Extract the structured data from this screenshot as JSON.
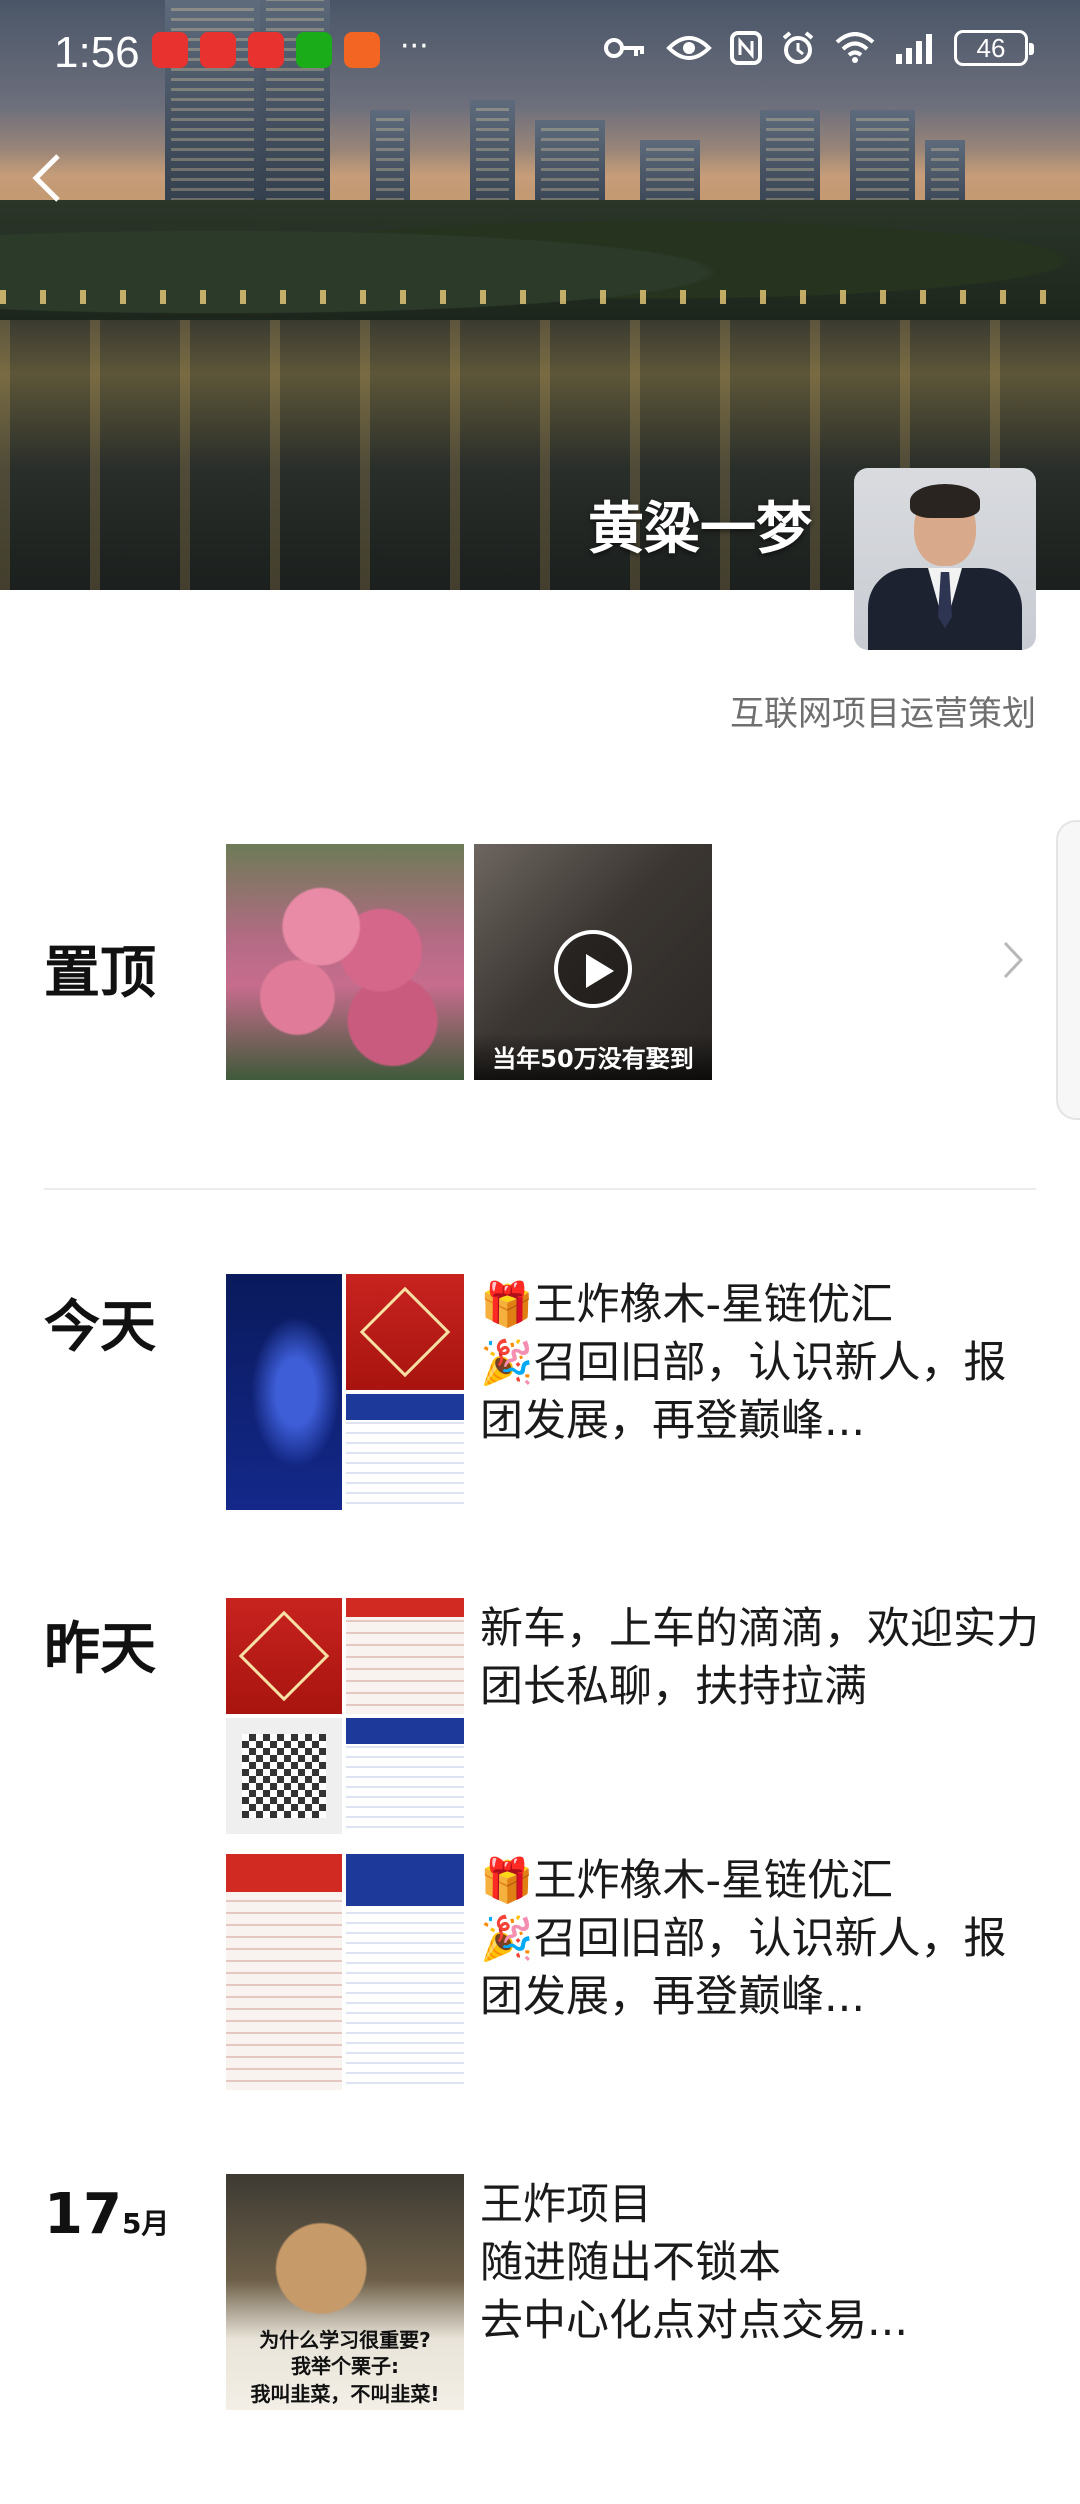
{
  "status_bar": {
    "time": "1:56",
    "battery": "46",
    "app_icon_colors": [
      "#e8322f",
      "#e8322f",
      "#e8322f",
      "#1aad19",
      "#f26522"
    ]
  },
  "profile": {
    "name": "黄粱一梦",
    "signature": "互联网项目运营策划"
  },
  "pinned": {
    "label": "置顶",
    "video_caption": "当年50万没有娶到"
  },
  "posts": [
    {
      "label": "今天",
      "lines": [
        "🎁王炸橡木-星链优汇",
        "🎉召回旧部，认识新人，报团发展，再登巅峰..."
      ]
    },
    {
      "label": "昨天",
      "lines": [
        "新车，上车的滴滴，欢迎实力团长私聊，扶持拉满"
      ]
    },
    {
      "label": "",
      "lines": [
        "🎁王炸橡木-星链优汇",
        "🎉召回旧部，认识新人，报团发展，再登巅峰..."
      ]
    },
    {
      "day": "17",
      "month": "5月",
      "lines": [
        "王炸项目",
        "随进随出不锁本",
        "去中心化点对点交易..."
      ],
      "meme_top": "为什么学习很重要?",
      "meme_mid": "我举个栗子:",
      "meme_bottom": "我叫韭菜，不叫韭菜!"
    }
  ]
}
